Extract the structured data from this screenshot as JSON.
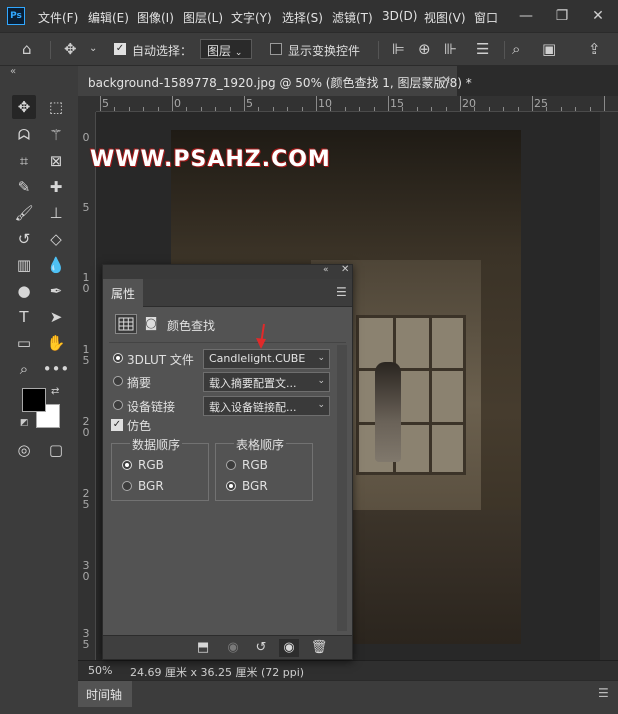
{
  "app": {
    "logo": "Ps"
  },
  "menu": [
    "文件(F)",
    "编辑(E)",
    "图像(I)",
    "图层(L)",
    "文字(Y)",
    "选择(S)",
    "滤镜(T)",
    "3D(D)",
    "视图(V)",
    "窗口"
  ],
  "options": {
    "auto_select_label": "自动选择：",
    "auto_select_checked": true,
    "target": "图层",
    "show_transform_label": "显示变换控件",
    "show_transform_checked": false
  },
  "document": {
    "tab_label": "background-1589778_1920.jpg @ 50% (颜色查找 1, 图层蒙版/8) *",
    "watermark": "WWW.PSAHZ.COM"
  },
  "ruler_top": [
    "5",
    "0",
    "5",
    "10",
    "15",
    "20",
    "25"
  ],
  "ruler_left": [
    [
      "0"
    ],
    [
      "5"
    ],
    [
      "1",
      "0"
    ],
    [
      "1",
      "5"
    ],
    [
      "2",
      "0"
    ],
    [
      "2",
      "5"
    ],
    [
      "3",
      "0"
    ],
    [
      "3",
      "5"
    ]
  ],
  "status": {
    "zoom": "50%",
    "doc_info": "24.69 厘米 x 36.25 厘米 (72 ppi)"
  },
  "timeline": {
    "label": "时间轴"
  },
  "properties": {
    "tab": "属性",
    "adjustment_title": "颜色查找",
    "rows": [
      {
        "label": "3DLUT 文件",
        "value": "Candlelight.CUBE",
        "selected": true
      },
      {
        "label": "摘要",
        "value": "载入摘要配置文...",
        "selected": false
      },
      {
        "label": "设备链接",
        "value": "载入设备链接配...",
        "selected": false
      }
    ],
    "dither_label": "仿色",
    "dither_checked": true,
    "data_order": {
      "title": "数据顺序",
      "options": [
        "RGB",
        "BGR"
      ],
      "selected": "RGB"
    },
    "table_order": {
      "title": "表格顺序",
      "options": [
        "RGB",
        "BGR"
      ],
      "selected": "BGR"
    }
  },
  "colors": {
    "foreground": "#000000",
    "background": "#ffffff",
    "accent": "#31a8ff",
    "annotation_arrow": "#e02a2a"
  }
}
